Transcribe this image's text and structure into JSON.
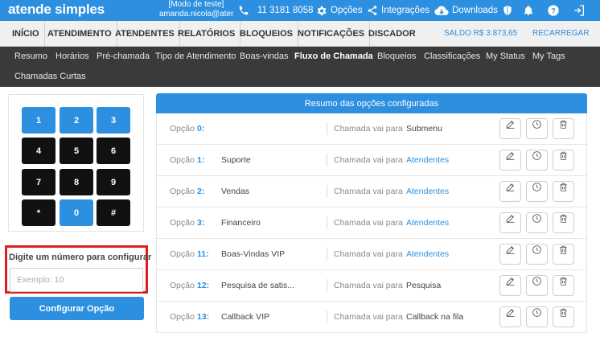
{
  "topbar": {
    "logo": "atende simples",
    "account_mode": "[Modo de teste]",
    "account_email": "amanda.nicola@atend...",
    "phone": "11 3181 8058",
    "options": "Opções",
    "integrations": "Integrações",
    "downloads": "Downloads"
  },
  "mainnav": {
    "items": [
      "INÍCIO",
      "ATENDIMENTO",
      "ATENDENTES",
      "RELATÓRIOS",
      "BLOQUEIOS",
      "NOTIFICAÇÕES",
      "DISCADOR"
    ],
    "saldo": "SALDO R$ 3.873,65",
    "recarregar": "RECARREGAR"
  },
  "subnav": {
    "items": [
      "Resumo",
      "Horários",
      "Pré-chamada",
      "Tipo de Atendimento",
      "Boas-vindas",
      "Fluxo de Chamada",
      "Bloqueios",
      "Classificações",
      "My Status",
      "My Tags",
      "Chamadas Curtas"
    ],
    "active": "Fluxo de Chamada"
  },
  "keypad": {
    "keys": [
      "1",
      "2",
      "3",
      "4",
      "5",
      "6",
      "7",
      "8",
      "9",
      "*",
      "0",
      "#"
    ]
  },
  "config": {
    "label": "Digite um número para configurar",
    "placeholder": "Exemplo: 10",
    "value": "",
    "button": "Configurar Opção"
  },
  "summary": {
    "title": "Resumo das opções configuradas",
    "option_label": "Opção",
    "goes_to_label": "Chamada vai para",
    "rows": [
      {
        "num": "0:",
        "name": "",
        "dest": "Submenu",
        "dest_link": false
      },
      {
        "num": "1:",
        "name": "Suporte",
        "dest": "Atendentes",
        "dest_link": true
      },
      {
        "num": "2:",
        "name": "Vendas",
        "dest": "Atendentes",
        "dest_link": true
      },
      {
        "num": "3:",
        "name": "Financeiro",
        "dest": "Atendentes",
        "dest_link": true
      },
      {
        "num": "11:",
        "name": "Boas-Vindas VIP",
        "dest": "Atendentes",
        "dest_link": true
      },
      {
        "num": "12:",
        "name": "Pesquisa de satis...",
        "dest": "Pesquisa",
        "dest_link": false
      },
      {
        "num": "13:",
        "name": "Callback VIP",
        "dest": "Callback na fila",
        "dest_link": false
      }
    ]
  },
  "colors": {
    "brand_blue": "#2d8fe0",
    "subnav_bg": "#3a3a3a",
    "highlight_red": "#e01e1e"
  }
}
